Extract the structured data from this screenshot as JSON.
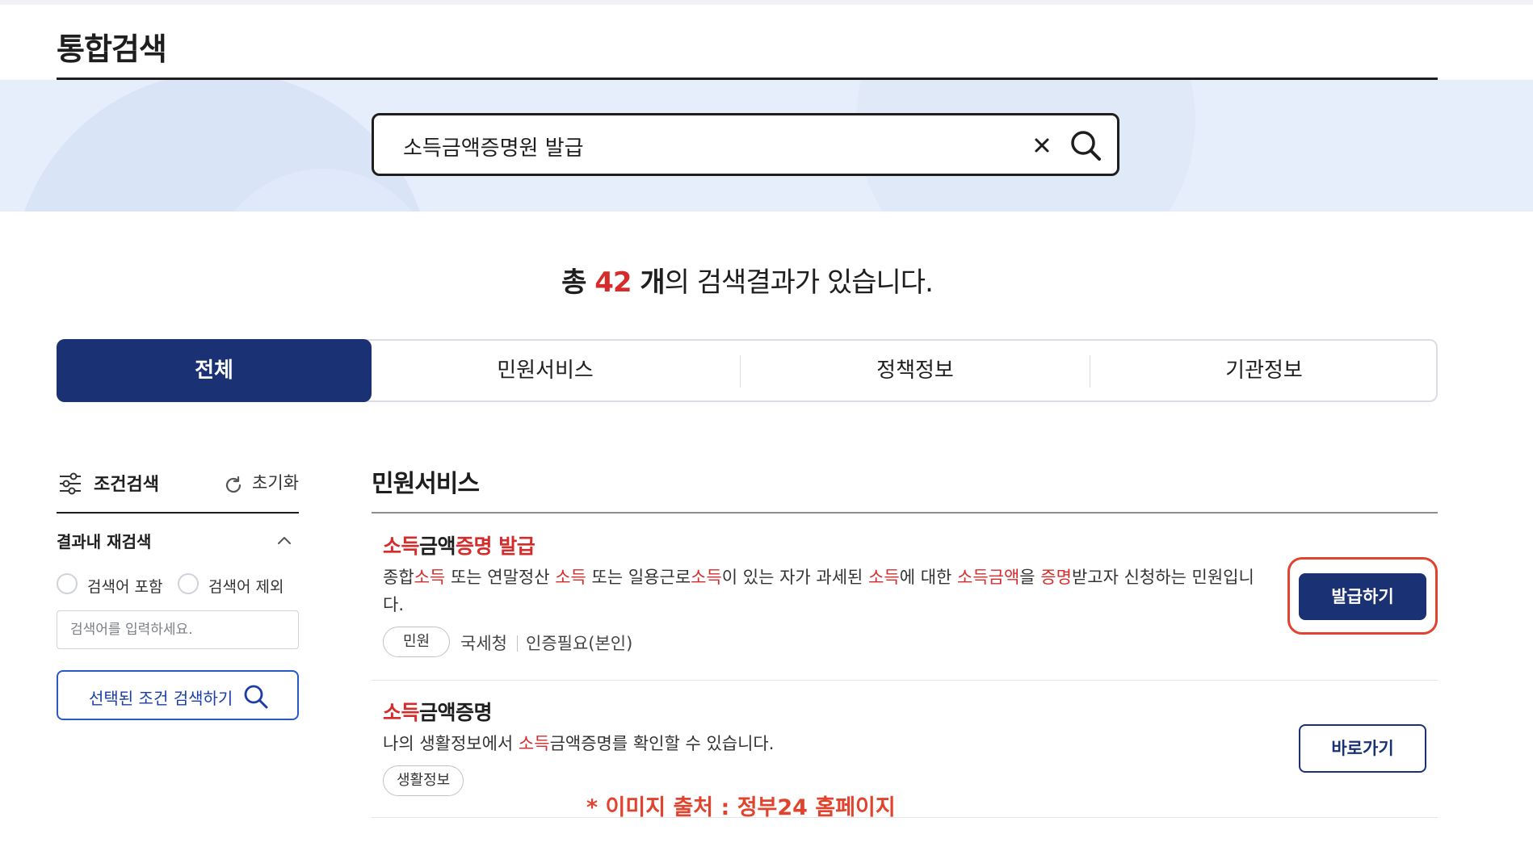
{
  "page": {
    "title": "통합검색"
  },
  "search": {
    "query": "소득금액증명원 발급"
  },
  "summary": {
    "prefix": "총 ",
    "count": "42",
    "unit": " 개",
    "suffix": "의 검색결과가 있습니다."
  },
  "tabs": [
    {
      "label": "전체",
      "active": true
    },
    {
      "label": "민원서비스",
      "active": false
    },
    {
      "label": "정책정보",
      "active": false
    },
    {
      "label": "기관정보",
      "active": false
    }
  ],
  "filter": {
    "title": "조건검색",
    "reset_label": "초기화",
    "refine_title": "결과내 재검색",
    "include_label": "검색어 포함",
    "exclude_label": "검색어 제외",
    "input_placeholder": "검색어를 입력하세요.",
    "apply_label": "선택된 조건 검색하기"
  },
  "section": {
    "title": "민원서비스"
  },
  "results": [
    {
      "title_parts": [
        {
          "text": "소득",
          "hl": true
        },
        {
          "text": "금액",
          "hl": false
        },
        {
          "text": "증명 발급",
          "hl": true
        }
      ],
      "desc_parts": [
        {
          "text": "종합",
          "hl": false
        },
        {
          "text": "소득",
          "hl": true
        },
        {
          "text": " 또는 연말정산 ",
          "hl": false
        },
        {
          "text": "소득",
          "hl": true
        },
        {
          "text": " 또는 일용근로",
          "hl": false
        },
        {
          "text": "소득",
          "hl": true
        },
        {
          "text": "이 있는 자가 과세된 ",
          "hl": false
        },
        {
          "text": "소득",
          "hl": true
        },
        {
          "text": "에 대한 ",
          "hl": false
        },
        {
          "text": "소득금액",
          "hl": true
        },
        {
          "text": "을 ",
          "hl": false
        },
        {
          "text": "증명",
          "hl": true
        },
        {
          "text": "받고자 신청하는 민원입니다.",
          "hl": false
        }
      ],
      "tag": "민원",
      "agency": "국세청",
      "auth": "인증필요(본인)",
      "action_label": "발급하기"
    },
    {
      "title_parts": [
        {
          "text": "소득",
          "hl": true
        },
        {
          "text": "금액증명",
          "hl": false
        }
      ],
      "desc_parts": [
        {
          "text": "나의 생활정보에서 ",
          "hl": false
        },
        {
          "text": "소득",
          "hl": true
        },
        {
          "text": "금액증명를 확인할 수 있습니다.",
          "hl": false
        }
      ],
      "tag": "생활정보",
      "action_label": "바로가기"
    }
  ],
  "note": "* 이미지 출처 : 정부24 홈페이지",
  "colors": {
    "primary": "#1a3273",
    "highlight": "#d52b2b",
    "annotation": "#e0442e"
  },
  "icons": [
    "close-icon",
    "search-icon",
    "filter-sliders-icon",
    "refresh-icon",
    "chevron-up-icon"
  ]
}
